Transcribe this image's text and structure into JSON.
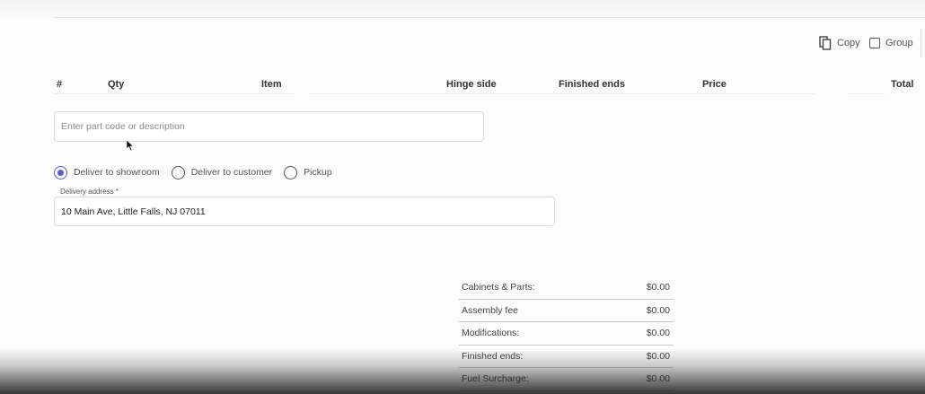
{
  "toolbar": {
    "copy_label": "Copy",
    "copy_icon": "copy-icon",
    "group_label": "Group",
    "group_checked": false
  },
  "table": {
    "columns": [
      "#",
      "Qty",
      "Item",
      "Hinge side",
      "Finished ends",
      "Price",
      "Total"
    ]
  },
  "search": {
    "placeholder": "Enter part code or description",
    "value": ""
  },
  "delivery": {
    "options": [
      {
        "label": "Deliver to showroom",
        "selected": true
      },
      {
        "label": "Deliver to customer",
        "selected": false
      },
      {
        "label": "Pickup",
        "selected": false
      }
    ],
    "address_label": "Delivery address *",
    "address_value": "10 Main Ave, Little Falls, NJ 07011",
    "accent_color": "#5b5fc7"
  },
  "summary": {
    "rows": [
      {
        "label": "Cabinets & Parts:",
        "value": "$0.00"
      },
      {
        "label": "Assembly fee",
        "value": "$0.00"
      },
      {
        "label": "Modifications:",
        "value": "$0.00"
      },
      {
        "label": "Finished ends:",
        "value": "$0.00"
      },
      {
        "label": "Fuel Surcharge:",
        "value": "$0.00"
      }
    ]
  }
}
